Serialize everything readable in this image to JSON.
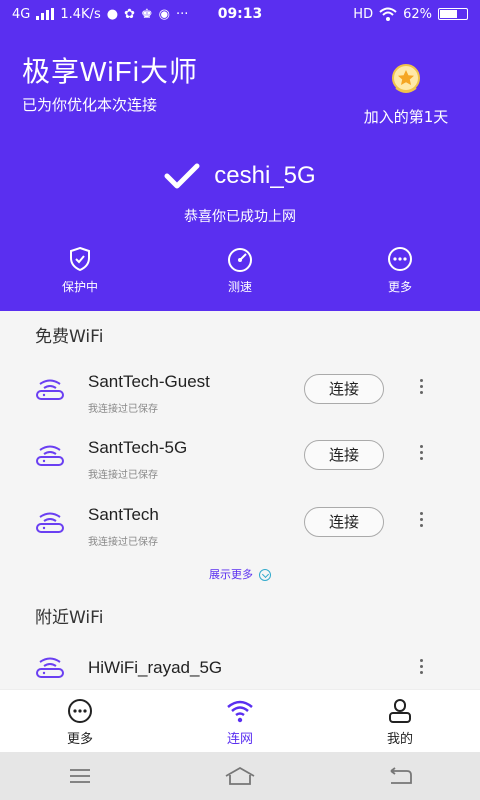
{
  "status_bar": {
    "network": "4G",
    "speed": "1.4K/s",
    "time": "09:13",
    "hd": "HD",
    "battery": "62%"
  },
  "header": {
    "title": "极享WiFi大师",
    "subtitle": "已为你优化本次连接",
    "badge_text": "加入的第1天"
  },
  "connection": {
    "ssid": "ceshi_5G",
    "message": "恭喜你已成功上网"
  },
  "actions": [
    {
      "label": "保护中",
      "icon": "shield-check-icon"
    },
    {
      "label": "测速",
      "icon": "speedometer-icon"
    },
    {
      "label": "更多",
      "icon": "more-circle-icon"
    }
  ],
  "free_wifi": {
    "title": "免费WiFi",
    "items": [
      {
        "name": "SantTech-Guest",
        "note": "我连接过已保存",
        "button": "连接"
      },
      {
        "name": "SantTech-5G",
        "note": "我连接过已保存",
        "button": "连接"
      },
      {
        "name": "SantTech",
        "note": "我连接过已保存",
        "button": "连接"
      }
    ],
    "show_more": "展示更多"
  },
  "nearby_wifi": {
    "title": "附近WiFi",
    "items": [
      {
        "name": "HiWiFi_rayad_5G"
      }
    ]
  },
  "tabs": [
    {
      "label": "更多",
      "icon": "more-circle-icon"
    },
    {
      "label": "连网",
      "icon": "wifi-icon"
    },
    {
      "label": "我的",
      "icon": "user-icon"
    }
  ],
  "colors": {
    "brand": "#5a2ff0",
    "background": "#f5f5f5"
  }
}
